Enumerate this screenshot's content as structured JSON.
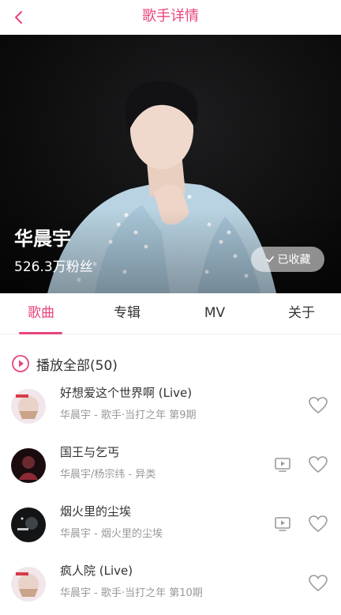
{
  "header": {
    "title": "歌手详情",
    "back_icon": "chevron-left-icon"
  },
  "singer": {
    "name": "华晨宇",
    "fans": "526.3万粉丝",
    "favorite_label": "已收藏"
  },
  "tabs": [
    {
      "label": "歌曲",
      "active": true
    },
    {
      "label": "专辑",
      "active": false
    },
    {
      "label": "MV",
      "active": false
    },
    {
      "label": "关于",
      "active": false
    }
  ],
  "play_all": {
    "label": "播放全部(50)"
  },
  "songs": [
    {
      "title": "好想爱这个世界啊 (Live)",
      "subtitle": "华晨宇 - 歌手·当打之年 第9期",
      "has_mv": false
    },
    {
      "title": "国王与乞丐",
      "subtitle": "华晨宇/杨宗纬 - 异类",
      "has_mv": true
    },
    {
      "title": "烟火里的尘埃",
      "subtitle": "华晨宇 - 烟火里的尘埃",
      "has_mv": true
    },
    {
      "title": "疯人院 (Live)",
      "subtitle": "华晨宇 - 歌手·当打之年 第10期",
      "has_mv": false
    }
  ],
  "colors": {
    "accent": "#e8457c",
    "text": "#333333",
    "muted": "#999999"
  }
}
